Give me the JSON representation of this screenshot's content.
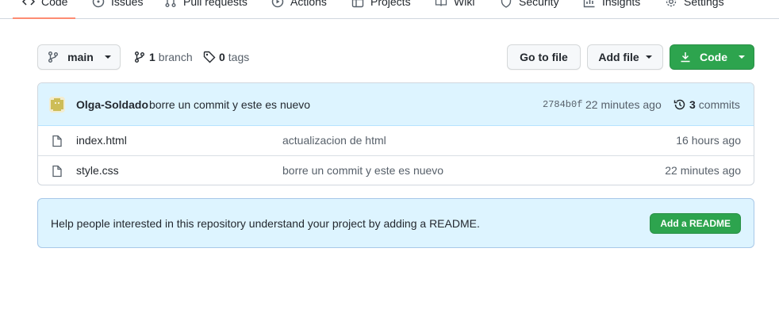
{
  "repo_nav": {
    "tabs": [
      {
        "label": "Code",
        "icon": "code-icon"
      },
      {
        "label": "Issues",
        "icon": "issue-icon"
      },
      {
        "label": "Pull requests",
        "icon": "pull-request-icon"
      },
      {
        "label": "Actions",
        "icon": "play-icon"
      },
      {
        "label": "Projects",
        "icon": "table-icon"
      },
      {
        "label": "Wiki",
        "icon": "book-icon"
      },
      {
        "label": "Security",
        "icon": "shield-icon"
      },
      {
        "label": "Insights",
        "icon": "graph-icon"
      },
      {
        "label": "Settings",
        "icon": "gear-icon"
      }
    ],
    "selected": "Code"
  },
  "file_nav": {
    "branch_button": "main",
    "branch_count": "1",
    "branch_label": "branch",
    "tag_count": "0",
    "tag_label": "tags",
    "go_to_file": "Go to file",
    "add_file": "Add file",
    "code_button": "Code"
  },
  "latest_commit": {
    "author": "Olga-Soldado",
    "message": "borre un commit y este es nuevo",
    "sha": "2784b0f",
    "age": "22 minutes ago",
    "commit_count": "3",
    "commit_label": "commits"
  },
  "files": [
    {
      "name": "index.html",
      "message": "actualizacion de html",
      "age": "16 hours ago",
      "icon": "file-icon"
    },
    {
      "name": "style.css",
      "message": "borre un commit y este es nuevo",
      "age": "22 minutes ago",
      "icon": "file-icon"
    }
  ],
  "readme_banner": {
    "text": "Help people interested in this repository understand your project by adding a README.",
    "button": "Add a README"
  },
  "colors": {
    "accent_green": "#2da44e",
    "header_blue": "#ddf4ff",
    "selected_tab_underline": "#fd8c73",
    "avatar_yellow": "#cdbd57"
  }
}
